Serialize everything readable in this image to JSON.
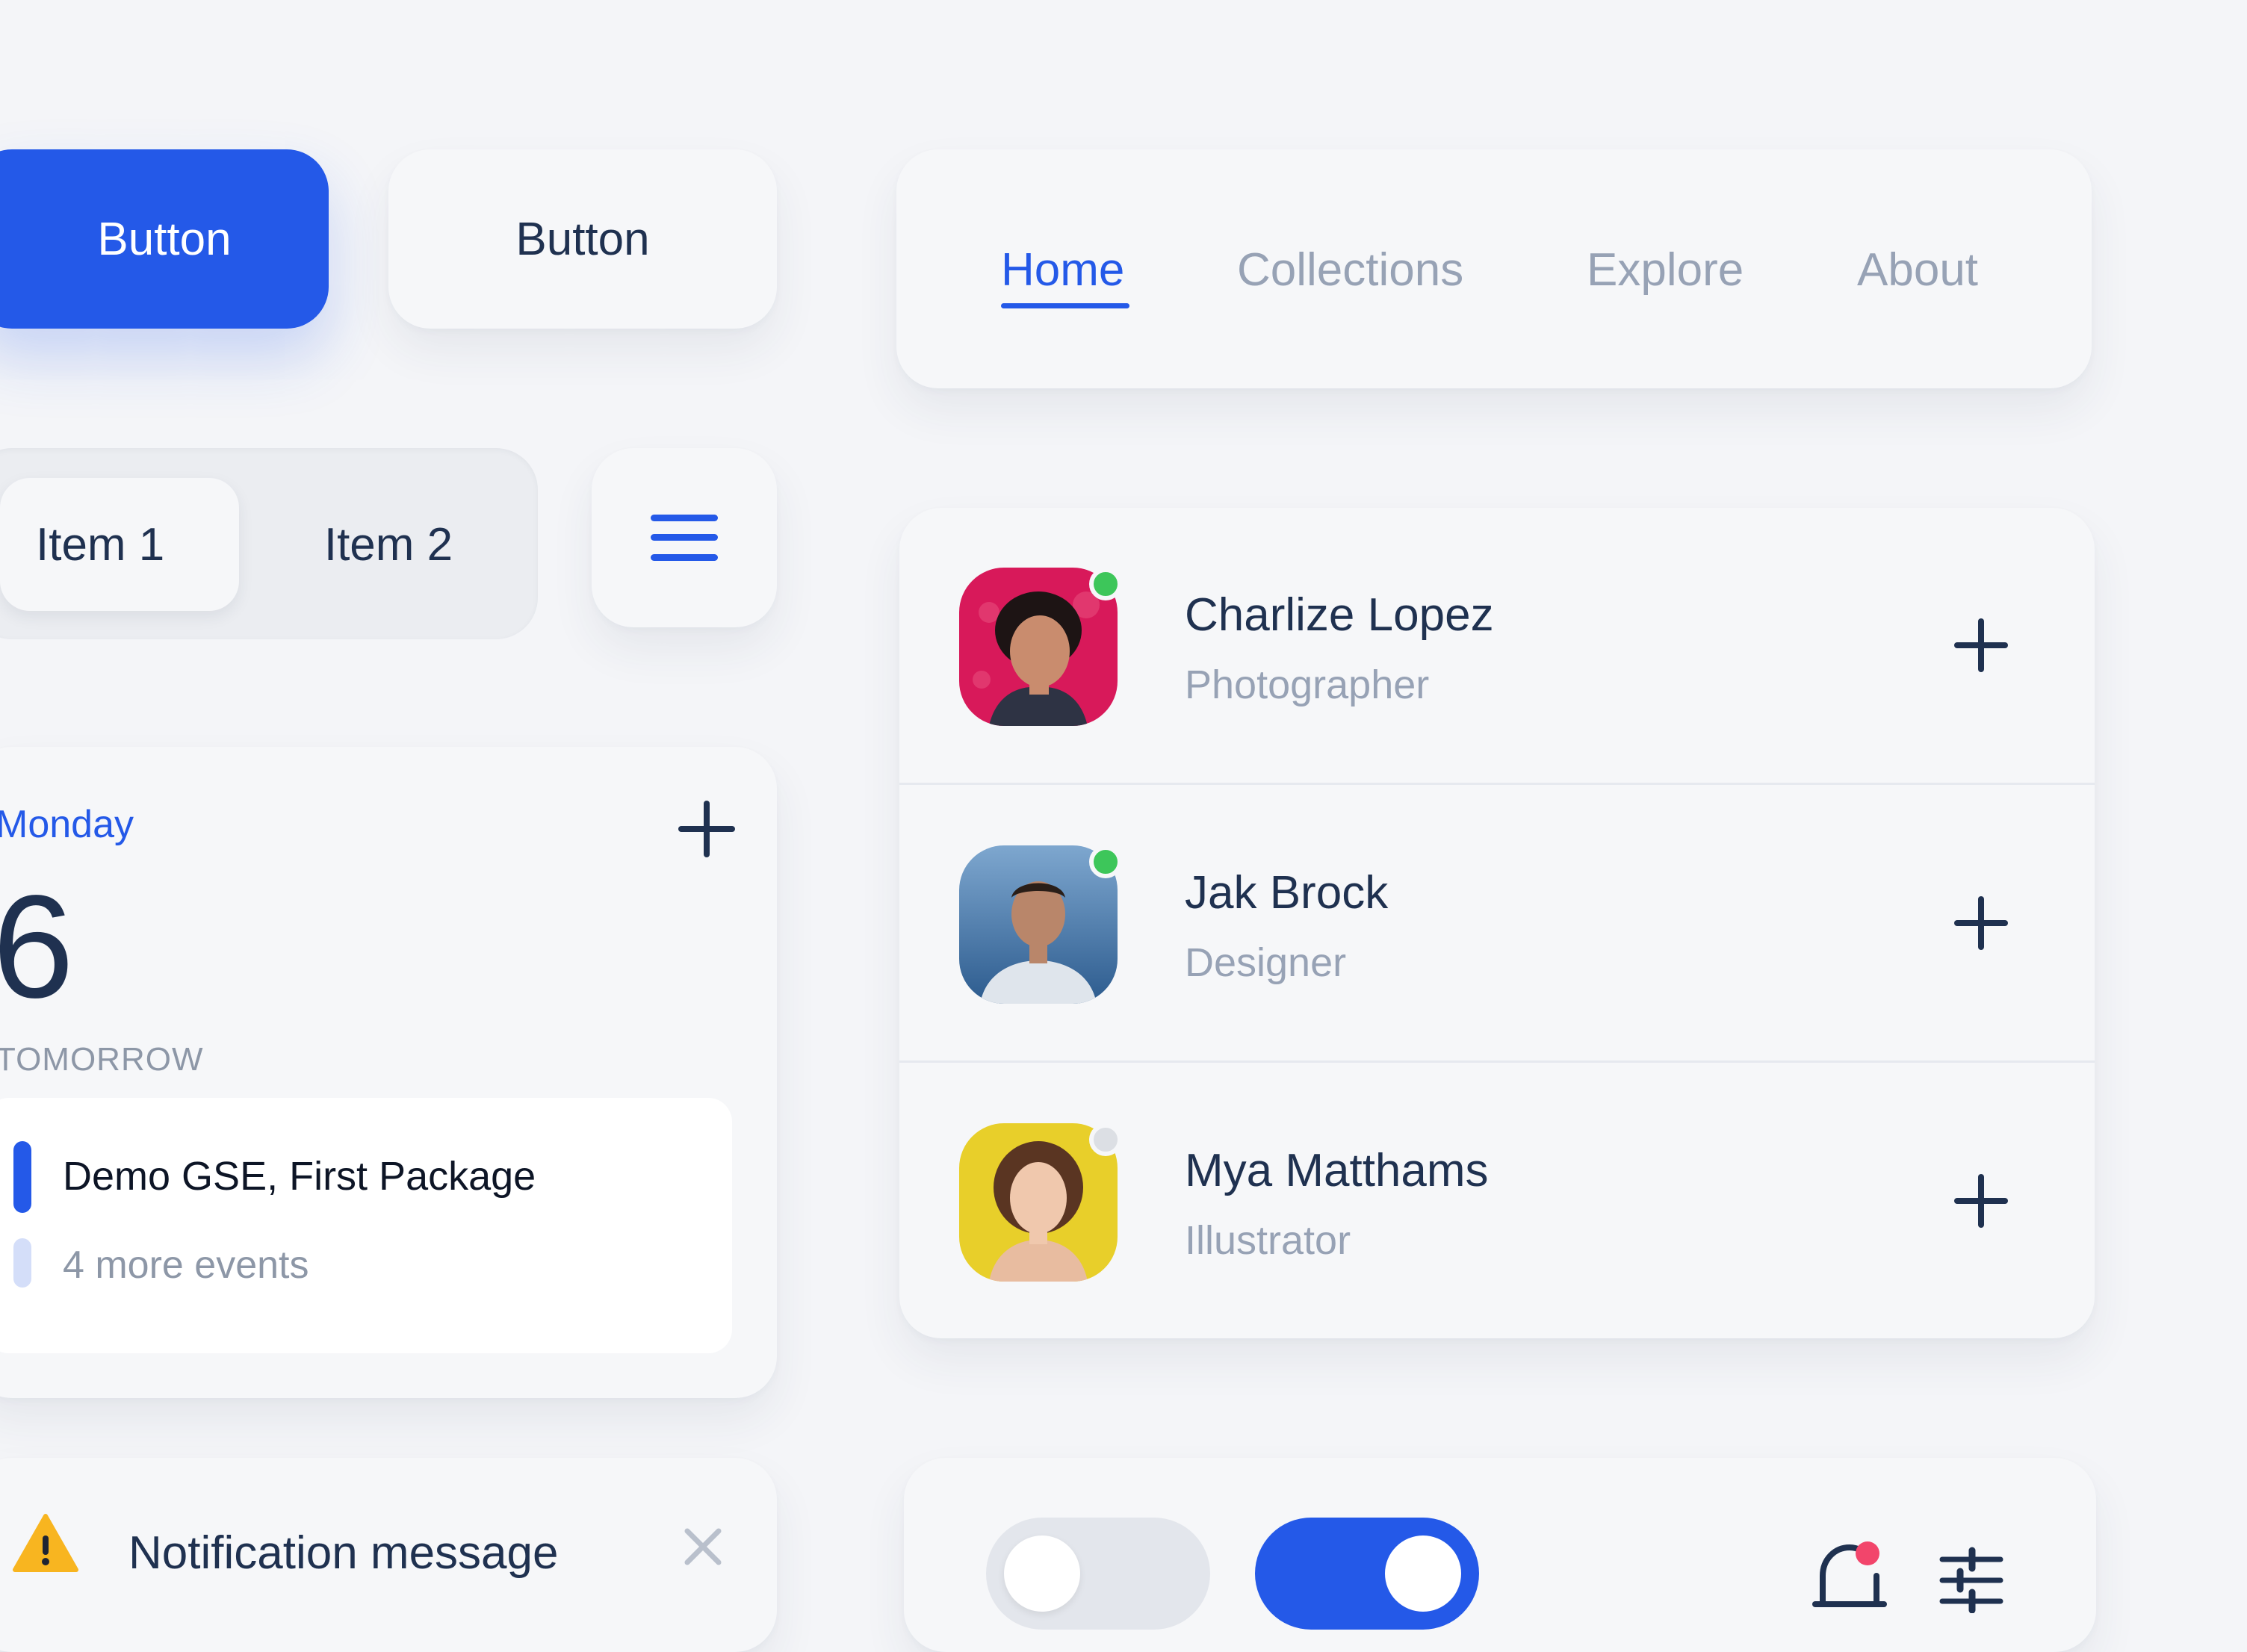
{
  "buttons": {
    "primary_label": "Button",
    "secondary_label": "Button"
  },
  "segmented": {
    "items": [
      {
        "label": "Item 1"
      },
      {
        "label": "Item 2"
      }
    ]
  },
  "calendar": {
    "day_name": "Monday",
    "day_number": "6",
    "section": "TOMORROW",
    "event_title": "Demo GSE, First Package",
    "more_events": "4 more events"
  },
  "notification": {
    "message": "Notification message"
  },
  "nav": {
    "items": [
      {
        "label": "Home"
      },
      {
        "label": "Collections"
      },
      {
        "label": "Explore"
      },
      {
        "label": "About"
      }
    ],
    "active": "Home"
  },
  "contacts": [
    {
      "name": "Charlize Lopez",
      "role": "Photographer",
      "status": "online"
    },
    {
      "name": "Jak Brock",
      "role": "Designer",
      "status": "online"
    },
    {
      "name": "Mya Matthams",
      "role": "Illustrator",
      "status": "offline"
    }
  ],
  "toggles": [
    {
      "state": "off"
    },
    {
      "state": "on"
    }
  ],
  "colors": {
    "accent": "#2459e8",
    "text_dark": "#1f3150",
    "text_muted": "#97a2b5",
    "online": "#3dc65a",
    "offline": "#dcdfe4",
    "alert_dot": "#f2456b",
    "warning": "#f8b520"
  },
  "icons": [
    "plus-icon",
    "hamburger-icon",
    "warning-icon",
    "close-icon",
    "bell-icon",
    "sliders-icon"
  ]
}
